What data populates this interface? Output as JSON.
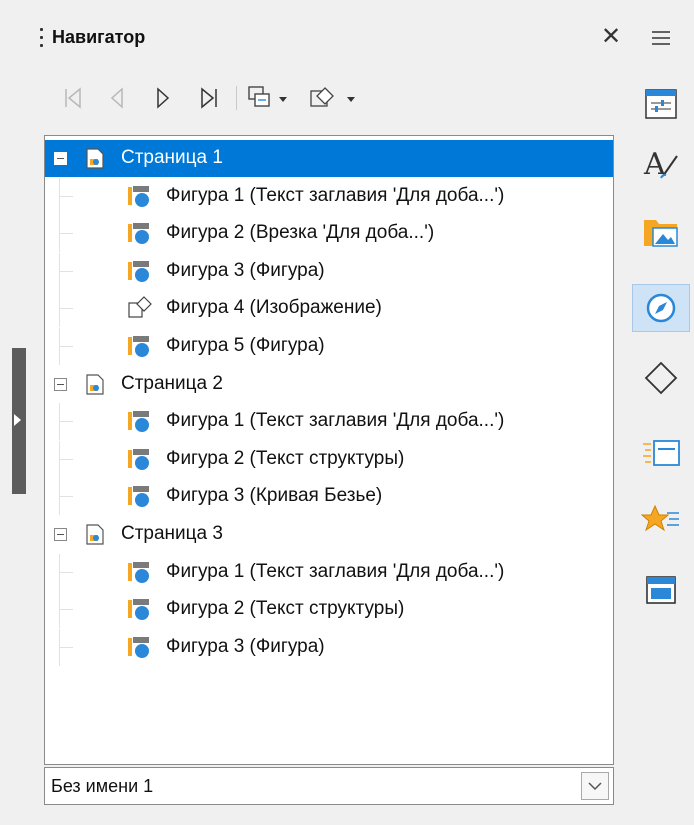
{
  "navigator": {
    "title": "Навигатор",
    "close_symbol": "✕",
    "toolbar": {
      "buttons": [
        "first-page-icon",
        "previous-page-icon",
        "next-page-icon",
        "last-page-icon",
        "drag-mode-icon",
        "shape-filter-icon"
      ]
    },
    "tree": [
      {
        "type": "page",
        "label": "Страница 1",
        "selected": true
      },
      {
        "type": "shape",
        "label": "Фигура 1 (Текст заглавия 'Для доба...')",
        "icon": "text-shape-icon"
      },
      {
        "type": "shape",
        "label": "Фигура 2 (Врезка 'Для доба...')",
        "icon": "text-shape-icon"
      },
      {
        "type": "shape",
        "label": "Фигура 3 (Фигура)",
        "icon": "text-shape-icon"
      },
      {
        "type": "shape",
        "label": "Фигура 4 (Изображение)",
        "icon": "image-shape-icon"
      },
      {
        "type": "shape",
        "label": "Фигура 5 (Фигура)",
        "icon": "text-shape-icon"
      },
      {
        "type": "page",
        "label": "Страница 2",
        "selected": false
      },
      {
        "type": "shape",
        "label": "Фигура 1 (Текст заглавия 'Для доба...')",
        "icon": "text-shape-icon"
      },
      {
        "type": "shape",
        "label": "Фигура 2 (Текст структуры)",
        "icon": "text-shape-icon"
      },
      {
        "type": "shape",
        "label": "Фигура 3 (Кривая Безье)",
        "icon": "text-shape-icon"
      },
      {
        "type": "page",
        "label": "Страница 3",
        "selected": false
      },
      {
        "type": "shape",
        "label": "Фигура 1 (Текст заглавия 'Для доба...')",
        "icon": "text-shape-icon"
      },
      {
        "type": "shape",
        "label": "Фигура 2 (Текст структуры)",
        "icon": "text-shape-icon"
      },
      {
        "type": "shape",
        "label": "Фигура 3 (Фигура)",
        "icon": "text-shape-icon"
      }
    ],
    "document_select": {
      "value": "Без имени 1"
    }
  },
  "sidebar_tabs": [
    {
      "name": "menu-icon"
    },
    {
      "name": "properties-icon"
    },
    {
      "name": "styles-icon"
    },
    {
      "name": "gallery-icon"
    },
    {
      "name": "navigator-icon",
      "active": true
    },
    {
      "name": "shapes-icon"
    },
    {
      "name": "slide-transition-icon"
    },
    {
      "name": "animation-icon"
    },
    {
      "name": "master-slides-icon"
    }
  ],
  "colors": {
    "selection": "#0078d7",
    "accent_blue": "#2b88d8",
    "accent_orange": "#f5a623"
  }
}
